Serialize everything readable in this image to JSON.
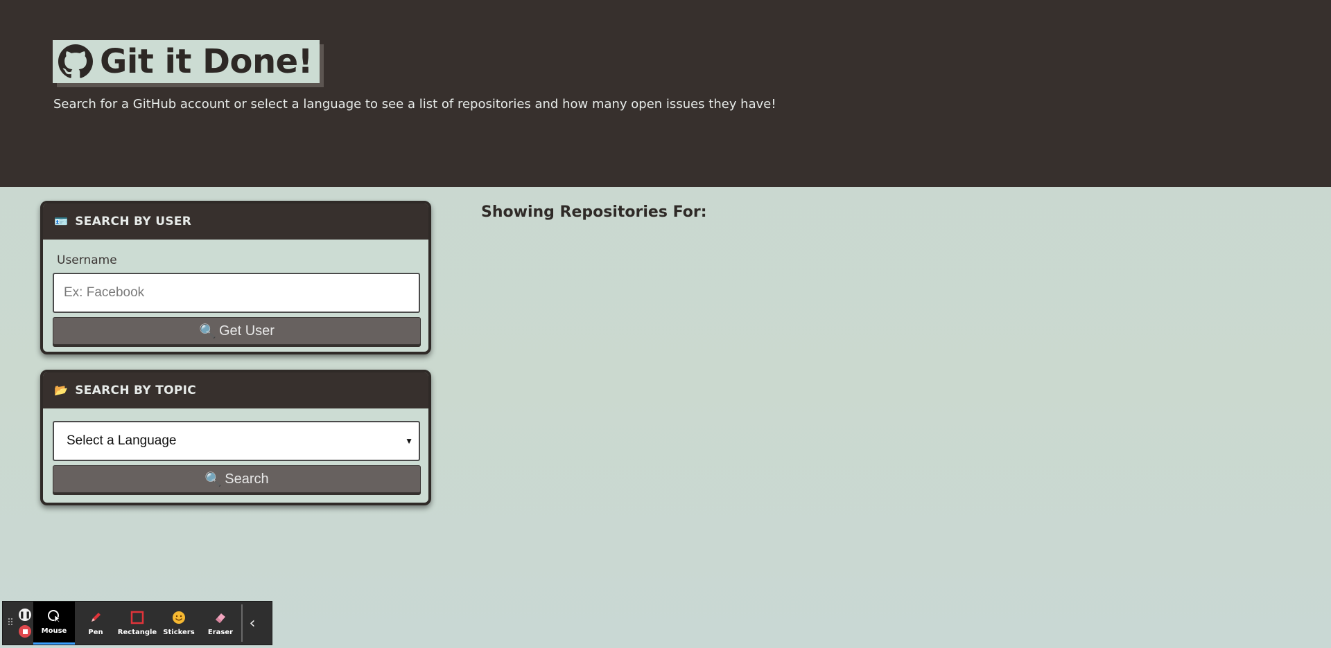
{
  "header": {
    "title": "Git it Done!",
    "logo_icon": "github-icon",
    "tagline": "Search for a GitHub account or select a language to see a list of repositories and how many open issues they have!"
  },
  "search_user": {
    "heading": "SEARCH BY USER",
    "icon": "user-card-icon",
    "label": "Username",
    "placeholder": "Ex: Facebook",
    "value": "",
    "button_label": "Get User",
    "button_icon": "magnifier-icon"
  },
  "search_topic": {
    "heading": "SEARCH BY TOPIC",
    "icon": "folder-icon",
    "select_value": "Select a Language",
    "button_label": "Search",
    "button_icon": "magnifier-icon"
  },
  "results": {
    "title": "Showing Repositories For:"
  },
  "toolbar": {
    "tools": [
      {
        "label": "Mouse",
        "icon": "mouse-cursor-icon",
        "active": true
      },
      {
        "label": "Pen",
        "icon": "pen-icon",
        "active": false
      },
      {
        "label": "Rectangle",
        "icon": "rectangle-icon",
        "active": false
      },
      {
        "label": "Stickers",
        "icon": "sticker-icon",
        "active": false
      },
      {
        "label": "Eraser",
        "icon": "eraser-icon",
        "active": false
      }
    ]
  },
  "colors": {
    "header_bg": "#37302d",
    "page_bg": "#c9d8d2",
    "button_bg": "#67615f",
    "accent": "#3aa0ff"
  }
}
